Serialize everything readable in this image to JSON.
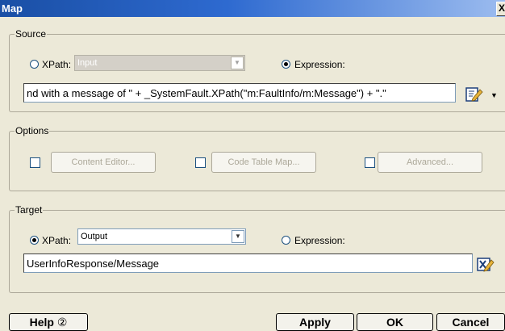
{
  "window": {
    "title": "Map",
    "close_glyph": "X"
  },
  "source": {
    "legend": "Source",
    "xpath_label": "XPath:",
    "xpath_value": "Input",
    "expression_label": "Expression:",
    "selected": "expression",
    "expression_text": "nd with a message of \" + _SystemFault.XPath(\"m:FaultInfo/m:Message\") + \".\""
  },
  "options": {
    "legend": "Options",
    "content_editor_label": "Content Editor...",
    "code_table_map_label": "Code Table Map...",
    "advanced_label": "Advanced..."
  },
  "target": {
    "legend": "Target",
    "xpath_label": "XPath:",
    "xpath_value": "Output",
    "expression_label": "Expression:",
    "selected": "xpath",
    "path_text": "UserInfoResponse/Message"
  },
  "buttons": {
    "help_label": "Help",
    "help_icon": "②",
    "apply_label": "Apply",
    "ok_label": "OK",
    "cancel_label": "Cancel"
  },
  "colors": {
    "titlebar": "#2e6ad0",
    "dialog_bg": "#ece9d8"
  }
}
